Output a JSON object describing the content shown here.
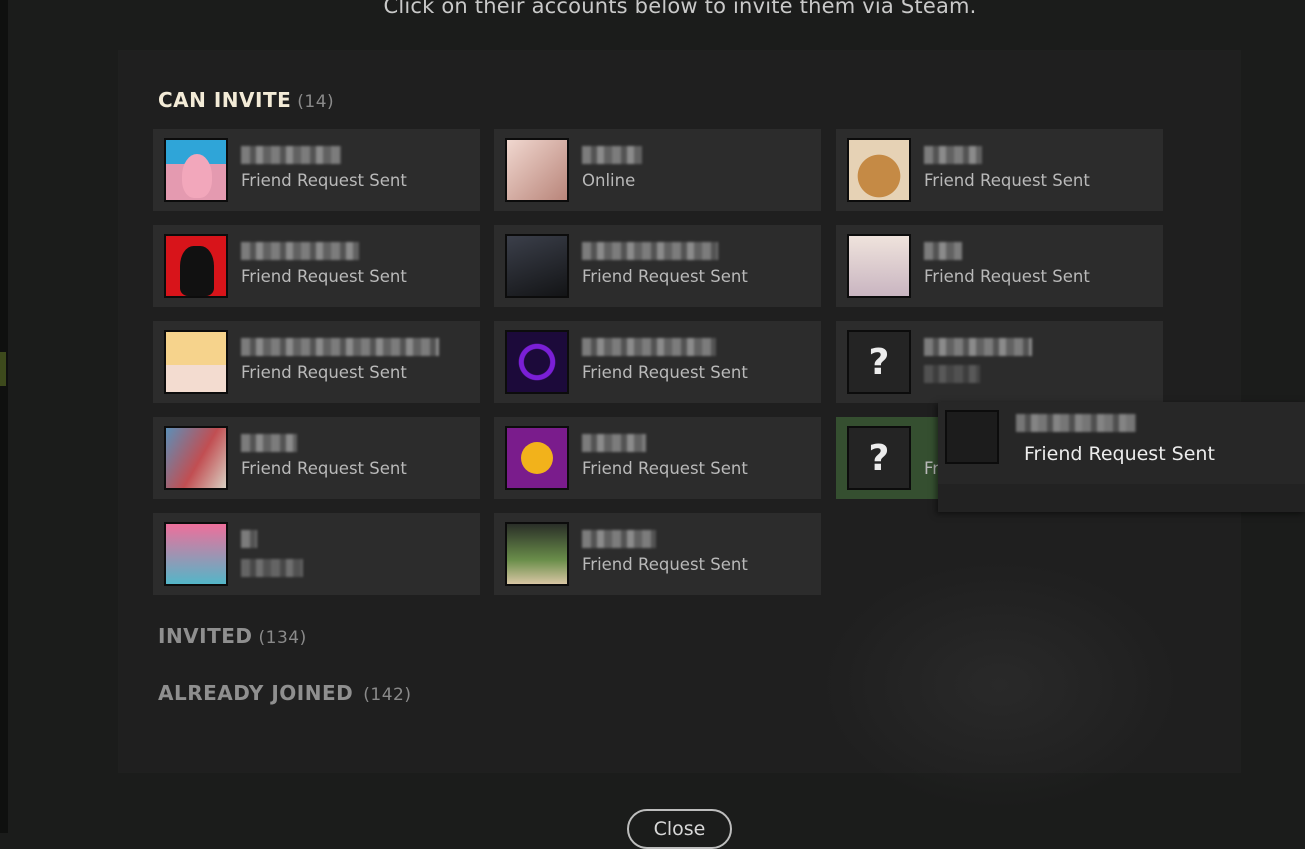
{
  "instruction": "Click on their accounts below to invite them via Steam.",
  "sections": {
    "can_invite": {
      "title": "CAN INVITE",
      "count": "(14)"
    },
    "invited": {
      "title": "INVITED",
      "count": "(134)"
    },
    "already_joined": {
      "title": "ALREADY JOINED",
      "count": "(142)"
    }
  },
  "cards": [
    {
      "status": "Friend Request Sent",
      "avatar": "cartoon-starfish-avatar"
    },
    {
      "status": "Online",
      "avatar": "anime-girl-avatar"
    },
    {
      "status": "Friend Request Sent",
      "avatar": "dog-avatar"
    },
    {
      "status": "Friend Request Sent",
      "avatar": "counter-strike-avatar"
    },
    {
      "status": "Friend Request Sent",
      "avatar": "dark-portrait-avatar"
    },
    {
      "status": "Friend Request Sent",
      "avatar": "anime-girl-avatar"
    },
    {
      "status": "Friend Request Sent",
      "avatar": "anime-blonde-avatar"
    },
    {
      "status": "Friend Request Sent",
      "avatar": "neon-smiley-avatar"
    },
    {
      "status": "",
      "avatar": "unknown-avatar"
    },
    {
      "status": "Friend Request Sent",
      "avatar": "photo-avatar"
    },
    {
      "status": "Friend Request Sent",
      "avatar": "emoji-avatar"
    },
    {
      "status": "Fr",
      "avatar": "unknown-avatar"
    },
    {
      "status": "",
      "avatar": "anime-pink-avatar"
    },
    {
      "status": "Friend Request Sent",
      "avatar": "boy-photo-avatar"
    }
  ],
  "unknown_avatar_glyph": "?",
  "tooltip": {
    "status": "Friend Request Sent"
  },
  "close_button": {
    "label": "Close"
  }
}
